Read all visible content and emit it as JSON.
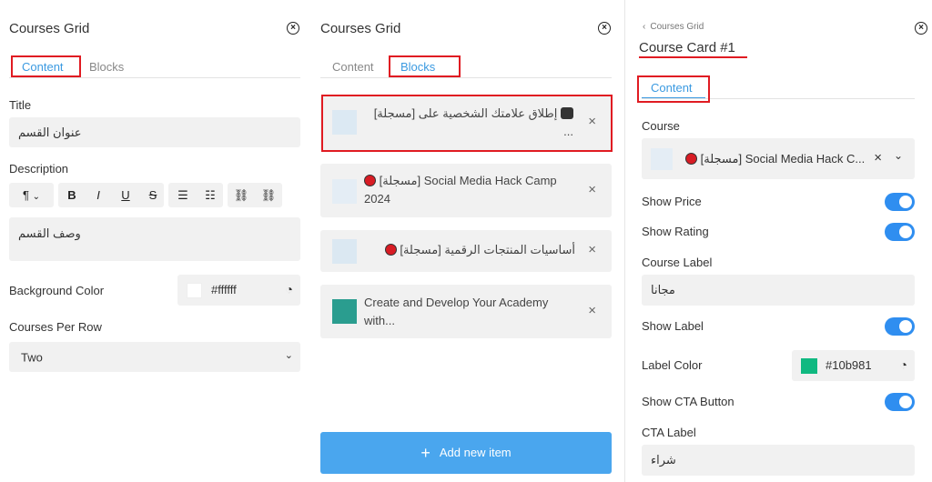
{
  "left_panel": {
    "title": "Courses Grid",
    "tabs": [
      {
        "label": "Content"
      },
      {
        "label": "Blocks"
      }
    ],
    "title_label": "Title",
    "title_value": "عنوان القسم",
    "description_label": "Description",
    "toolbar": {
      "paragraph": "¶",
      "bold": "B",
      "italic": "I",
      "underline": "U",
      "strike": "S",
      "ul": "☰",
      "ol": "☷",
      "link": "⛓",
      "unlink": "⛓"
    },
    "description_value": "وصف القسم",
    "bg_label": "Background Color",
    "bg_value": "#ffffff",
    "per_row_label": "Courses Per Row",
    "per_row_value": "Two",
    "per_row_options": [
      "Two"
    ]
  },
  "middle_panel": {
    "title": "Courses Grid",
    "tabs": [
      {
        "label": "Content"
      },
      {
        "label": "Blocks"
      }
    ],
    "blocks": [
      {
        "line1": "إطلاق علامتك الشخصية على [مسجلة]",
        "line2": "..."
      },
      {
        "line1": "[مسجلة] Social Media Hack Camp",
        "line2": "2024"
      },
      {
        "line1": "أساسيات المنتجات الرقمية [مسجلة]",
        "line2": ""
      },
      {
        "line1": "Create and Develop Your Academy",
        "line2": "with..."
      }
    ],
    "add_label": "Add new item"
  },
  "right_panel": {
    "breadcrumb": "Courses Grid",
    "title": "Course Card #1",
    "tab": "Content",
    "course_label": "Course",
    "course_value": "[مسجلة] Social Media Hack C...",
    "show_price": "Show Price",
    "show_rating": "Show Rating",
    "course_label_label": "Course Label",
    "course_label_value": "مجانا",
    "show_label": "Show Label",
    "label_color_label": "Label Color",
    "label_color_value": "#10b981",
    "show_cta": "Show CTA Button",
    "cta_label": "CTA Label",
    "cta_value": "شراء"
  },
  "colors": {
    "accent": "#3b9ae1",
    "highlight": "#e01b22",
    "toggle": "#2f8ef0",
    "label_color": "#10b981",
    "add_button": "#4aa6ee"
  }
}
